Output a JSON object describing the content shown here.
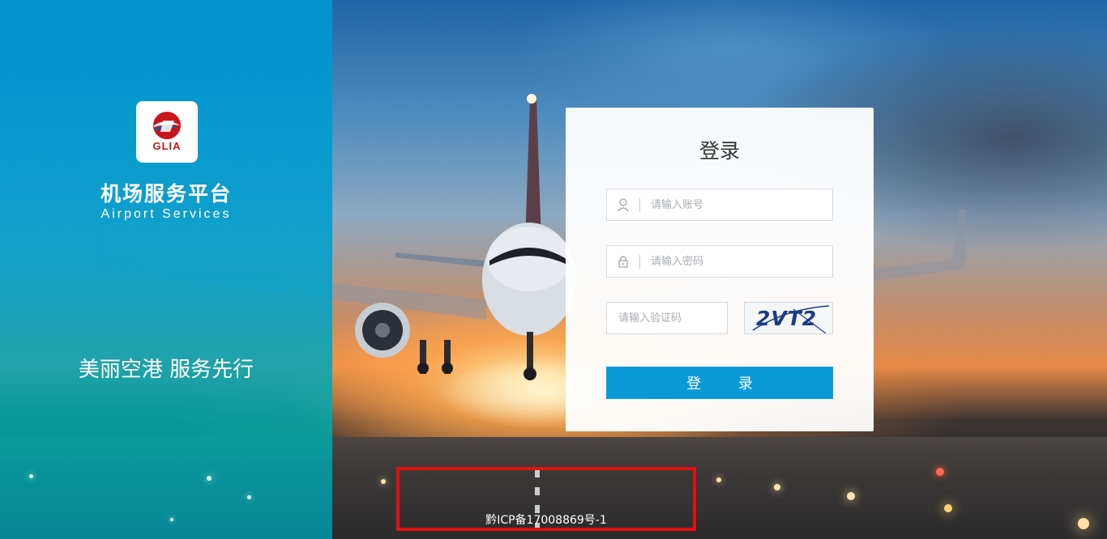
{
  "brand": {
    "logo_text": "GLIA",
    "title_cn": "机场服务平台",
    "title_en": "Airport Services",
    "slogan": "美丽空港 服务先行"
  },
  "login": {
    "title": "登录",
    "account_placeholder": "请输入账号",
    "password_placeholder": "请输入密码",
    "captcha_placeholder": "请输入验证码",
    "captcha_text": "2VT2",
    "submit_label": "登 录"
  },
  "footer": {
    "icp": "黔ICP备17008869号-1"
  },
  "colors": {
    "brand_panel": "#0096d2",
    "button": "#0a9ad8",
    "highlight_border": "#e21010",
    "logo_red": "#c8161d"
  },
  "icons": [
    "user-icon",
    "lock-icon",
    "logo-icon"
  ]
}
